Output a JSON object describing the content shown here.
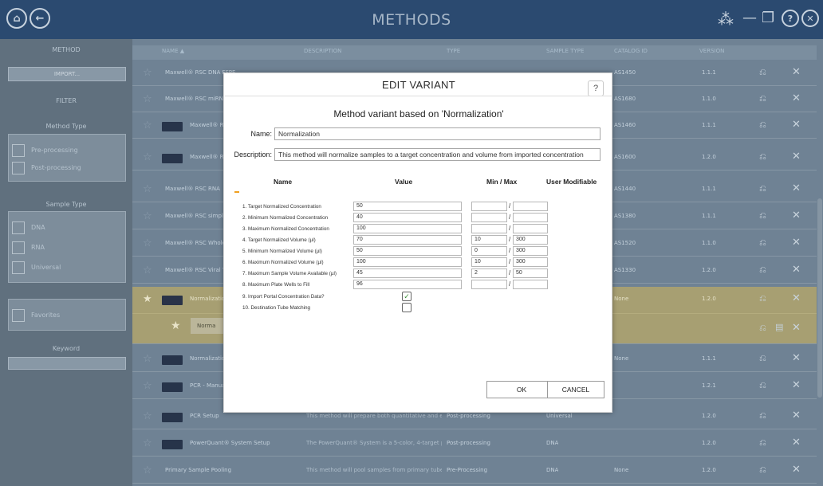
{
  "header": {
    "title": "METHODS"
  },
  "sidebar": {
    "method_heading": "METHOD",
    "import_label": "IMPORT...",
    "filter_heading": "FILTER",
    "method_type_heading": "Method Type",
    "method_types": [
      "Pre-processing",
      "Post-processing"
    ],
    "sample_type_heading": "Sample Type",
    "sample_types": [
      "DNA",
      "RNA",
      "Universal"
    ],
    "favorites_label": "Favorites",
    "keyword_heading": "Keyword",
    "keyword_value": ""
  },
  "table": {
    "columns": [
      "NAME",
      "DESCRIPTION",
      "TYPE",
      "SAMPLE TYPE",
      "CATALOG ID",
      "VERSION"
    ],
    "rows": [
      {
        "name": "Maxwell® RSC DNA FFPE",
        "desc": "",
        "type": "",
        "sample": "",
        "catalog": "AS1450",
        "version": "1.1.1"
      },
      {
        "name": "Maxwell® RSC miRNA",
        "desc": "",
        "type": "",
        "sample": "",
        "catalog": "AS1680",
        "version": "1.1.0"
      },
      {
        "name": "Maxwell® RSC",
        "desc": "",
        "type": "",
        "sample": "",
        "catalog": "AS1460",
        "version": "1.1.1"
      },
      {
        "name": "Maxwell® RSC",
        "desc": "",
        "type": "",
        "sample": "",
        "catalog": "AS1600",
        "version": "1.2.0"
      },
      {
        "name": "Maxwell® RSC RNA",
        "desc": "",
        "type": "",
        "sample": "",
        "catalog": "AS1440",
        "version": "1.1.1"
      },
      {
        "name": "Maxwell® RSC simpl",
        "desc": "",
        "type": "",
        "sample": "",
        "catalog": "AS1380",
        "version": "1.1.1"
      },
      {
        "name": "Maxwell® RSC Whole",
        "desc": "",
        "type": "",
        "sample": "",
        "catalog": "AS1520",
        "version": "1.1.0"
      },
      {
        "name": "Maxwell® RSC Viral T",
        "desc": "",
        "type": "",
        "sample": "",
        "catalog": "AS1330",
        "version": "1.2.0"
      },
      {
        "name": "Normalization",
        "desc": "",
        "type": "",
        "sample": "",
        "catalog": "None",
        "version": "1.2.0"
      },
      {
        "name": "Norma",
        "desc": "",
        "type": "",
        "sample": "",
        "catalog": "",
        "version": ""
      },
      {
        "name": "Normalization",
        "desc": "",
        "type": "",
        "sample": "",
        "catalog": "None",
        "version": "1.1.1"
      },
      {
        "name": "PCR - Manual",
        "desc": "",
        "type": "",
        "sample": "",
        "catalog": "",
        "version": "1.2.1"
      },
      {
        "name": "PCR Setup",
        "desc": "This method will prepare both quantitative and end-poi...",
        "type": "Post-processing",
        "sample": "Universal",
        "catalog": "",
        "version": "1.2.0"
      },
      {
        "name": "PowerQuant® System Setup",
        "desc": "The PowerQuant® System is a 5-color, 4-target probe-...",
        "type": "Post-processing",
        "sample": "DNA",
        "catalog": "",
        "version": "1.2.0"
      },
      {
        "name": "Primary Sample Pooling",
        "desc": "This method will pool samples from primary tubes into...",
        "type": "Pre-Processing",
        "sample": "DNA",
        "catalog": "None",
        "version": "1.2.0"
      }
    ]
  },
  "dialog": {
    "title": "EDIT VARIANT",
    "help": "?",
    "subtitle": "Method variant based on 'Normalization'",
    "name_label": "Name:",
    "name_value": "Normalization",
    "description_label": "Description:",
    "description_value": "This method will normalize samples to a target concentration and volume from imported concentration",
    "col_name": "Name",
    "col_value": "Value",
    "col_minmax": "Min / Max",
    "col_user": "User Modifiable",
    "params": [
      {
        "label": "1. Target Normalized Concentration",
        "value": "50",
        "min": "",
        "max": ""
      },
      {
        "label": "2. Minimum Normalized Concentration",
        "value": "40",
        "min": "",
        "max": ""
      },
      {
        "label": "3. Maximum Normalized Concentration",
        "value": "100",
        "min": "",
        "max": ""
      },
      {
        "label": "4. Target Normalized Volume (µl)",
        "value": "70",
        "min": "10",
        "max": "300"
      },
      {
        "label": "5. Minimum Normalized Volume (µl)",
        "value": "50",
        "min": "0",
        "max": "300"
      },
      {
        "label": "6. Maximum Normalized Volume (µl)",
        "value": "100",
        "min": "10",
        "max": "300"
      },
      {
        "label": "7. Maximum Sample Volume Available (µl)",
        "value": "45",
        "min": "2",
        "max": "50"
      },
      {
        "label": "8. Maximum Plate Wells to Fill",
        "value": "96",
        "min": "",
        "max": ""
      }
    ],
    "checks": [
      {
        "label": "9. Import Portal Concentration Data?",
        "mark": "✓"
      },
      {
        "label": "10. Destination Tube Matching",
        "mark": ""
      }
    ],
    "ok_label": "OK",
    "cancel_label": "CANCEL"
  },
  "colors": {
    "header": "#2b4a70",
    "selected_row": "#a79f72",
    "check": "#3b8f35"
  }
}
